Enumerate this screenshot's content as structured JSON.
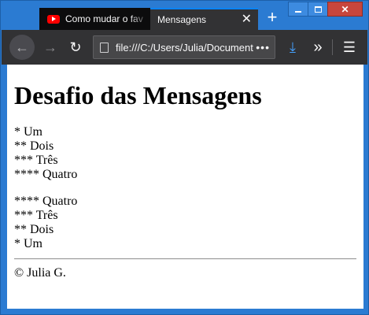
{
  "tabs": [
    {
      "label": "Como mudar o fav",
      "icon": "youtube-icon",
      "active": false
    },
    {
      "label": "Mensagens",
      "icon": "",
      "active": true
    }
  ],
  "toolbar": {
    "url": "file:///C:/Users/Julia/Documents",
    "more": "•••"
  },
  "page": {
    "title": "Desafio das Mensagens",
    "list_up": [
      "* Um",
      "** Dois",
      "*** Três",
      "**** Quatro"
    ],
    "list_down": [
      "**** Quatro",
      "*** Três",
      "** Dois",
      "* Um"
    ],
    "footer": "© Julia G."
  },
  "colors": {
    "titlebar": "#2b7bd2",
    "toolbar": "#323234",
    "accent": "#0a84ff",
    "download": "#45a1ff"
  }
}
